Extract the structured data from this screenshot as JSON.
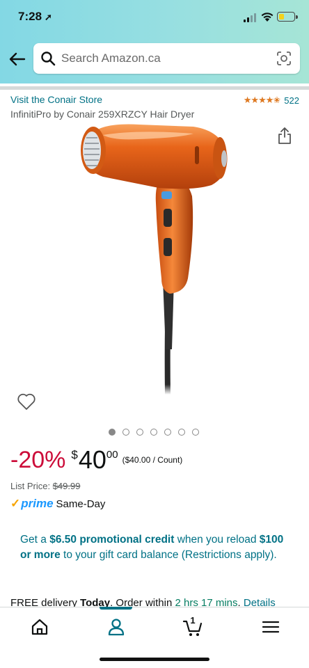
{
  "status_bar": {
    "time": "7:28",
    "location_arrow": "location-arrow-icon"
  },
  "header": {
    "search_placeholder": "Search Amazon.ca",
    "icons": [
      "back-arrow-icon",
      "search-icon",
      "camera-icon"
    ]
  },
  "product": {
    "store_link": "Visit the Conair Store",
    "rating_stars": "★★★★✬",
    "rating_count": "522",
    "title": "InfinitiPro by Conair 259XRZCY Hair Dryer",
    "image_count": 7,
    "active_image_index": 0
  },
  "pricing": {
    "discount": "-20%",
    "currency_symbol": "$",
    "whole": "40",
    "fraction": "00",
    "unit_price": "($40.00 / Count)",
    "list_price_label": "List Price:",
    "list_price_value": "$49.99"
  },
  "prime": {
    "check": "✓",
    "word": "prime",
    "sameday": "Same-Day"
  },
  "promo": {
    "part1": "Get a ",
    "bold1": "$6.50 promotional credit",
    "part2": " when you reload ",
    "bold2": "$100 or more",
    "part3": " to your gift card balance (Restrictions apply)."
  },
  "delivery": {
    "part1": "FREE delivery ",
    "bold": "Today",
    "part2": ". Order within ",
    "countdown": "2 hrs 17 mins",
    "part3": ". ",
    "details": "Details"
  },
  "bottom_nav": {
    "items": [
      "home-icon",
      "account-icon",
      "cart-icon",
      "menu-icon"
    ],
    "cart_count": "1",
    "active": "account-icon"
  },
  "colors": {
    "header_gradient_start": "#83d8e4",
    "header_gradient_end": "#a6e5d6",
    "link": "#007185",
    "discount": "#cc0c39",
    "star": "#de7921",
    "prime_blue": "#1a98ff",
    "product_orange": "#e8651a"
  }
}
